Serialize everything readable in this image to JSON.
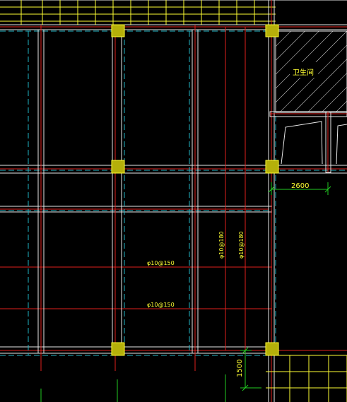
{
  "colors": {
    "background": "#000000",
    "grid_red": "#e0201c",
    "axis_cyan": "#1fb3c4",
    "wall_white": "#e8e8e8",
    "rebar_yellow": "#ffff33",
    "column_fill": "#b5b00a",
    "dim_green": "#22cc22"
  },
  "labels": {
    "room": "卫生间",
    "rebar_h1": "φ10@150",
    "rebar_h2": "φ10@150",
    "rebar_v1": "φ10@180",
    "rebar_v2": "φ10@180"
  },
  "dimensions": {
    "dim_horizontal": "2600",
    "dim_vertical": "1500"
  }
}
